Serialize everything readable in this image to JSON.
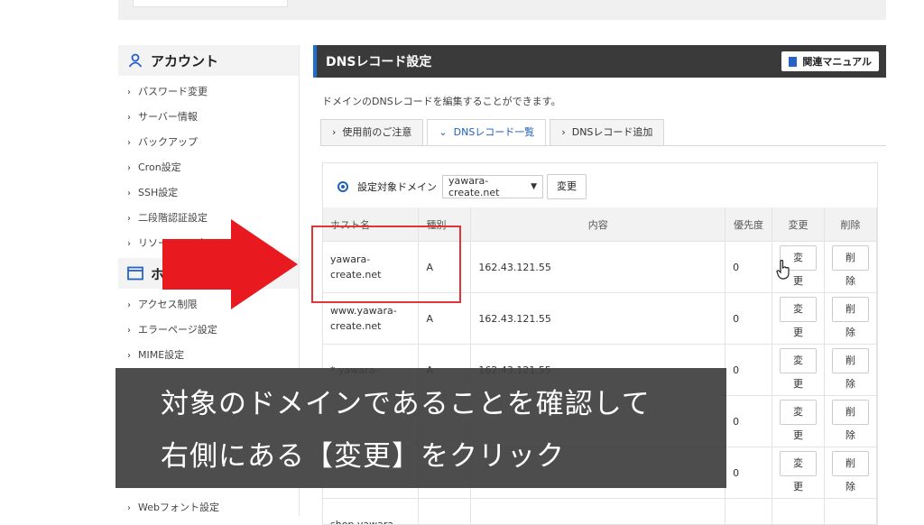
{
  "sidebar": {
    "account_title": "アカウント",
    "account_items": [
      "パスワード変更",
      "サーバー情報",
      "バックアップ",
      "Cron設定",
      "SSH設定",
      "二段階認証設定",
      "リソースモニター"
    ],
    "homepage_title": "ホ",
    "homepage_items": [
      "アクセス制限",
      "エラーページ設定",
      "MIME設定"
    ],
    "bottom_item": "Webフォント設定"
  },
  "main": {
    "title": "DNSレコード設定",
    "manual_button": "関連マニュアル",
    "description": "ドメインのDNSレコードを編集することができます。",
    "tabs": [
      {
        "label": "使用前のご注意",
        "chevron": "›"
      },
      {
        "label": "DNSレコード一覧",
        "chevron": "⌄"
      },
      {
        "label": "DNSレコード追加",
        "chevron": "›"
      }
    ],
    "domain_label": "設定対象ドメイン",
    "domain_value": "yawara-create.net",
    "change_button": "変更",
    "columns": [
      "ホスト名",
      "種別",
      "内容",
      "優先度",
      "変更",
      "削除"
    ],
    "rows": [
      {
        "host1": "yawara-",
        "host2": "create.net",
        "type": "A",
        "content": "162.43.121.55",
        "priority": "0",
        "edit": "変更",
        "delete": "削除"
      },
      {
        "host1": "www.yawara-",
        "host2": "create.net",
        "type": "A",
        "content": "162.43.121.55",
        "priority": "0",
        "edit": "変更",
        "delete": "削除"
      },
      {
        "host1": "*.yawara-",
        "host2": "",
        "type": "A",
        "content": "162.43.121.55",
        "priority": "0",
        "edit": "変更",
        "delete": "削除"
      },
      {
        "host1": "",
        "host2": "",
        "type": "",
        "content": "",
        "priority": "0",
        "edit": "変更",
        "delete": "削除"
      },
      {
        "host1": "",
        "host2": "",
        "type": "",
        "content": "",
        "priority": "0",
        "edit": "変更",
        "delete": "削除"
      },
      {
        "host1": "shop.yawara-",
        "host2": "",
        "type": "",
        "content": "",
        "priority": "",
        "edit": "",
        "delete": ""
      }
    ]
  },
  "caption": {
    "line1": "対象のドメインであることを確認して",
    "line2": "右側にある【変更】をクリック"
  },
  "colors": {
    "highlight": "#e2353a",
    "arrow": "#e8191f",
    "header": "#3a3a3a",
    "accent": "#1e5fb8"
  }
}
